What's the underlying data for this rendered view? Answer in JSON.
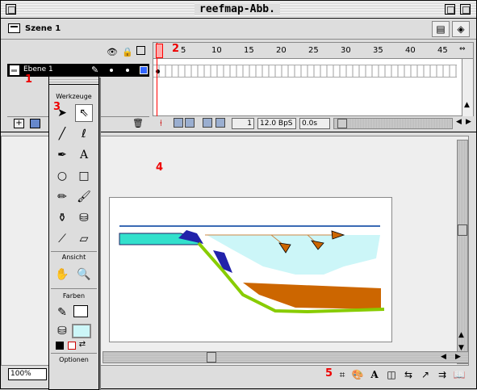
{
  "window": {
    "title": "reefmap-Abb."
  },
  "scene": {
    "label": "Szene 1"
  },
  "timeline": {
    "ruler_numbers": [
      "1",
      "5",
      "10",
      "15",
      "20",
      "25",
      "30",
      "35",
      "40",
      "45"
    ],
    "layer": {
      "name": "Ebene 1",
      "color": "#3366ff"
    },
    "current_frame": "1",
    "fps": "12.0 BpS",
    "elapsed": "0.0s"
  },
  "toolbox": {
    "title": "Werkzeuge",
    "view_label": "Ansicht",
    "colors_label": "Farben",
    "options_label": "Optionen"
  },
  "status": {
    "zoom": "100%"
  },
  "annotations": [
    "1",
    "2",
    "3",
    "4",
    "5"
  ],
  "colors": {
    "playhead": "#ff0000",
    "water_line": "#3a6ab4",
    "shallow": "#33e0cc",
    "lagoon": "#ccf6f8",
    "reef": "#2222aa",
    "sediment": "#cc6600",
    "slope": "#88cc00"
  }
}
